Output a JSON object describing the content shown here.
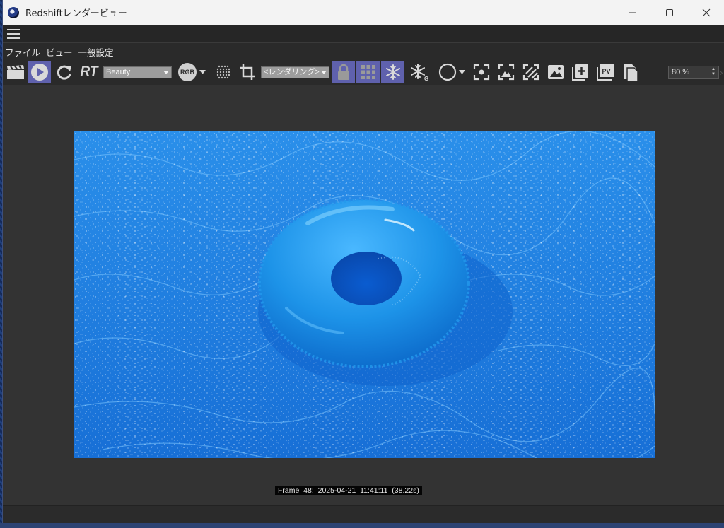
{
  "window": {
    "title": "Redshiftレンダービュー",
    "controls": {
      "minimize": "—",
      "maximize": "☐",
      "close": "✕"
    }
  },
  "menu": [
    "ファイル",
    "ビュー",
    "一般設定"
  ],
  "toolbar": {
    "aov_select": "Beauty",
    "color_mode": "RGB",
    "rt_label": "RT",
    "region_select": "<レンダリング>",
    "pv_label": "PV",
    "zoom": "80 %",
    "active_buttons": [
      "play-button",
      "lock-button",
      "grid-button",
      "freeze-button"
    ]
  },
  "icons": [
    "clapperboard-icon",
    "play-icon",
    "refresh-icon",
    "rt-icon",
    "rgb-icon",
    "dots-grid-icon",
    "crop-icon",
    "lock-icon",
    "tiles-icon",
    "snowflake-icon",
    "snowflake-g-icon",
    "circle-icon",
    "focus-icon",
    "expand-icon",
    "hatch-icon",
    "image-icon",
    "add-image-icon",
    "pv-icon",
    "copy-icon"
  ],
  "render": {
    "subject": "inflatable swim ring on water",
    "frame_info": "Frame  48:  2025-04-21  11:41:11  (38.22s)"
  },
  "colors": {
    "accent_active": "#5f61ad",
    "water": "#1a82e0",
    "ring": "#2aa0f0"
  }
}
